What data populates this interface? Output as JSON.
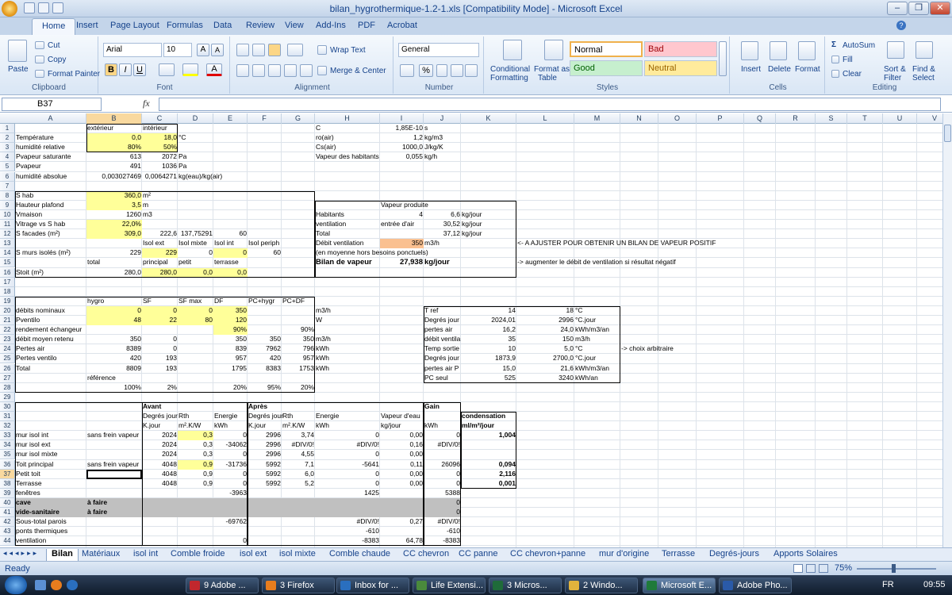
{
  "window": {
    "title": "bilan_hygrothermique-1.2-1.xls  [Compatibility Mode] - Microsoft Excel"
  },
  "ribbon": {
    "tabs": [
      "Home",
      "Insert",
      "Page Layout",
      "Formulas",
      "Data",
      "Review",
      "View",
      "Add-Ins",
      "PDF",
      "Acrobat"
    ],
    "clipboard": {
      "paste": "Paste",
      "cut": "Cut",
      "copy": "Copy",
      "format_painter": "Format Painter",
      "label": "Clipboard"
    },
    "font": {
      "name": "Arial",
      "size": "10",
      "label": "Font"
    },
    "alignment": {
      "wrap": "Wrap Text",
      "merge": "Merge & Center",
      "label": "Alignment"
    },
    "number": {
      "format": "General",
      "label": "Number"
    },
    "styles": {
      "conditional": "Conditional",
      "formatting": "Formatting",
      "format_as": "Format as",
      "table": "Table",
      "normal": "Normal",
      "bad": "Bad",
      "good": "Good",
      "neutral": "Neutral",
      "label": "Styles"
    },
    "cells": {
      "insert": "Insert",
      "delete": "Delete",
      "format": "Format",
      "label": "Cells"
    },
    "editing": {
      "autosum": "AutoSum",
      "fill": "Fill",
      "clear": "Clear",
      "sort": "Sort &",
      "filter": "Filter",
      "find": "Find &",
      "select": "Select",
      "label": "Editing"
    }
  },
  "formula_bar": {
    "name_box": "B37",
    "fx": "fx",
    "formula": ""
  },
  "columns": [
    "A",
    "B",
    "C",
    "D",
    "E",
    "F",
    "G",
    "H",
    "I",
    "J",
    "K",
    "L",
    "M",
    "N",
    "O",
    "P",
    "Q",
    "R",
    "S",
    "T",
    "U",
    "V"
  ],
  "rows": [
    "1",
    "2",
    "3",
    "4",
    "5",
    "6",
    "7",
    "8",
    "9",
    "10",
    "11",
    "12",
    "13",
    "14",
    "15",
    "16",
    "17",
    "18",
    "19",
    "20",
    "21",
    "22",
    "23",
    "24",
    "25",
    "26",
    "27",
    "28",
    "29",
    "30",
    "31",
    "32",
    "33",
    "34",
    "35",
    "36",
    "37",
    "38",
    "39",
    "40",
    "41",
    "42",
    "43",
    "44"
  ],
  "cells": [
    [
      "B1",
      "extérieur"
    ],
    [
      "C1",
      "intérieur"
    ],
    [
      "H1",
      "C"
    ],
    [
      "I1",
      "1,85E-10"
    ],
    [
      "J1",
      "s"
    ],
    [
      "A2",
      "Température"
    ],
    [
      "B2",
      "0,0"
    ],
    [
      "C2",
      "18,0"
    ],
    [
      "D2",
      "°C"
    ],
    [
      "H2",
      "ro(air)"
    ],
    [
      "I2",
      "1,2"
    ],
    [
      "J2",
      "kg/m3"
    ],
    [
      "A3",
      "humidité relative"
    ],
    [
      "B3",
      "80%"
    ],
    [
      "C3",
      "50%"
    ],
    [
      "H3",
      "Cs(air)"
    ],
    [
      "I3",
      "1000,0"
    ],
    [
      "J3",
      "J/kg/K"
    ],
    [
      "A4",
      "Pvapeur saturante"
    ],
    [
      "B4",
      "613"
    ],
    [
      "C4",
      "2072"
    ],
    [
      "D4",
      "Pa"
    ],
    [
      "H4",
      "Vapeur des habitants"
    ],
    [
      "I4",
      "0,055"
    ],
    [
      "J4",
      "kg/h"
    ],
    [
      "A5",
      "Pvapeur"
    ],
    [
      "B5",
      "491"
    ],
    [
      "C5",
      "1036"
    ],
    [
      "D5",
      "Pa"
    ],
    [
      "A6",
      "humidité absolue"
    ],
    [
      "B6",
      "0,003027469"
    ],
    [
      "C6",
      "0,0064271"
    ],
    [
      "D6",
      "kg(eau)/kg(air)"
    ],
    [
      "A8",
      "S hab"
    ],
    [
      "B8",
      "360,0"
    ],
    [
      "C8",
      "m²"
    ],
    [
      "A9",
      "Hauteur plafond"
    ],
    [
      "B9",
      "3,5"
    ],
    [
      "C9",
      "m"
    ],
    [
      "I9",
      "Vapeur produite"
    ],
    [
      "A10",
      "Vmaison"
    ],
    [
      "B10",
      "1260"
    ],
    [
      "C10",
      "m3"
    ],
    [
      "H10",
      "Habitants"
    ],
    [
      "I10",
      "4"
    ],
    [
      "J10",
      "6,6"
    ],
    [
      "K10",
      "kg/jour"
    ],
    [
      "A11",
      "Vitrage vs S hab"
    ],
    [
      "B11",
      "22,0%"
    ],
    [
      "H11",
      "ventilation"
    ],
    [
      "I11",
      "entrée d'air"
    ],
    [
      "J11",
      "30,52"
    ],
    [
      "K11",
      "kg/jour"
    ],
    [
      "A12",
      "S facades (m²)"
    ],
    [
      "B12",
      "309,0"
    ],
    [
      "C12",
      "222,6"
    ],
    [
      "D12",
      "137,75291"
    ],
    [
      "E12",
      "60"
    ],
    [
      "H12",
      "Total"
    ],
    [
      "J12",
      "37,12"
    ],
    [
      "K12",
      "kg/jour"
    ],
    [
      "C13",
      "Isol ext"
    ],
    [
      "D13",
      "Isol mixte"
    ],
    [
      "E13",
      "Isol int"
    ],
    [
      "F13",
      "Isol periph"
    ],
    [
      "H13",
      "Débit ventilation"
    ],
    [
      "I13",
      "350"
    ],
    [
      "J13",
      "m3/h"
    ],
    [
      "L13",
      "<- A AJUSTER POUR OBTENIR UN BILAN DE VAPEUR POSITIF"
    ],
    [
      "A14",
      "S murs isolés (m²)"
    ],
    [
      "B14",
      "229"
    ],
    [
      "C14",
      "229"
    ],
    [
      "D14",
      "0"
    ],
    [
      "E14",
      "0"
    ],
    [
      "F14",
      "60"
    ],
    [
      "H14",
      "(en moyenne hors besoins ponctuels)"
    ],
    [
      "B15",
      "total"
    ],
    [
      "C15",
      "principal"
    ],
    [
      "D15",
      "petit"
    ],
    [
      "E15",
      "terrasse"
    ],
    [
      "H15",
      "Bilan de vapeur"
    ],
    [
      "I15",
      "27,938"
    ],
    [
      "J15",
      "kg/jour"
    ],
    [
      "L15",
      "-> augmenter le débit de ventilation si résultat négatif"
    ],
    [
      "A16",
      "Stoit (m²)"
    ],
    [
      "B16",
      "280,0"
    ],
    [
      "C16",
      "280,0"
    ],
    [
      "D16",
      "0,0"
    ],
    [
      "E16",
      "0,0"
    ],
    [
      "B19",
      "hygro"
    ],
    [
      "C19",
      "SF"
    ],
    [
      "D19",
      "SF max"
    ],
    [
      "E19",
      "DF"
    ],
    [
      "F19",
      "PC+hygr"
    ],
    [
      "G19",
      "PC+DF"
    ],
    [
      "A20",
      "débits nominaux"
    ],
    [
      "B20",
      "0"
    ],
    [
      "C20",
      "0"
    ],
    [
      "D20",
      "0"
    ],
    [
      "E20",
      "350"
    ],
    [
      "H20",
      "m3/h"
    ],
    [
      "J20",
      "T ref"
    ],
    [
      "K20",
      "14"
    ],
    [
      "L20",
      "18"
    ],
    [
      "M20",
      "°C"
    ],
    [
      "A21",
      "Pventilo"
    ],
    [
      "B21",
      "48"
    ],
    [
      "C21",
      "22"
    ],
    [
      "D21",
      "80"
    ],
    [
      "E21",
      "120"
    ],
    [
      "H21",
      "W"
    ],
    [
      "J21",
      "Degrés jour"
    ],
    [
      "K21",
      "2024,01"
    ],
    [
      "L21",
      "2996"
    ],
    [
      "M21",
      "°C.jour"
    ],
    [
      "A22",
      "rendement échangeur"
    ],
    [
      "E22",
      "90%"
    ],
    [
      "G22",
      "90%"
    ],
    [
      "J22",
      "pertes air"
    ],
    [
      "K22",
      "16,2"
    ],
    [
      "L22",
      "24,0"
    ],
    [
      "M22",
      "kWh/m3/an"
    ],
    [
      "A23",
      "débit moyen retenu"
    ],
    [
      "B23",
      "350"
    ],
    [
      "C23",
      "0"
    ],
    [
      "E23",
      "350"
    ],
    [
      "F23",
      "350"
    ],
    [
      "G23",
      "350"
    ],
    [
      "H23",
      "m3/h"
    ],
    [
      "J23",
      "débit ventila"
    ],
    [
      "K23",
      "35"
    ],
    [
      "L23",
      "150"
    ],
    [
      "M23",
      "m3/h"
    ],
    [
      "A24",
      "Pertes air"
    ],
    [
      "B24",
      "8389"
    ],
    [
      "C24",
      "0"
    ],
    [
      "E24",
      "839"
    ],
    [
      "F24",
      "7962"
    ],
    [
      "G24",
      "796"
    ],
    [
      "H24",
      "kWh"
    ],
    [
      "J24",
      "Temp sortie"
    ],
    [
      "K24",
      "10"
    ],
    [
      "L24",
      "5,0"
    ],
    [
      "M24",
      "°C"
    ],
    [
      "N24",
      "-> choix arbitraire"
    ],
    [
      "A25",
      "Pertes ventilo"
    ],
    [
      "B25",
      "420"
    ],
    [
      "C25",
      "193"
    ],
    [
      "E25",
      "957"
    ],
    [
      "F25",
      "420"
    ],
    [
      "G25",
      "957"
    ],
    [
      "H25",
      "kWh"
    ],
    [
      "J25",
      "Degrés jour"
    ],
    [
      "K25",
      "1873,9"
    ],
    [
      "L25",
      "2700,0"
    ],
    [
      "M25",
      "°C.jour"
    ],
    [
      "A26",
      "Total"
    ],
    [
      "B26",
      "8809"
    ],
    [
      "C26",
      "193"
    ],
    [
      "E26",
      "1795"
    ],
    [
      "F26",
      "8383"
    ],
    [
      "G26",
      "1753"
    ],
    [
      "H26",
      "kWh"
    ],
    [
      "J26",
      "pertes air P"
    ],
    [
      "K26",
      "15,0"
    ],
    [
      "L26",
      "21,6"
    ],
    [
      "M26",
      "kWh/m3/an"
    ],
    [
      "B27",
      "référence"
    ],
    [
      "J27",
      "PC seul"
    ],
    [
      "K27",
      "525"
    ],
    [
      "L27",
      "3240"
    ],
    [
      "M27",
      "kWh/an"
    ],
    [
      "B28",
      "100%"
    ],
    [
      "C28",
      "2%"
    ],
    [
      "E28",
      "20%"
    ],
    [
      "F28",
      "95%"
    ],
    [
      "G28",
      "20%"
    ],
    [
      "C30",
      "Avant"
    ],
    [
      "F30",
      "Après"
    ],
    [
      "J30",
      "Gain"
    ],
    [
      "C31",
      "Degrés jour"
    ],
    [
      "D31",
      "Rth"
    ],
    [
      "E31",
      "Energie"
    ],
    [
      "F31",
      "Degrés jour"
    ],
    [
      "G31",
      "Rth"
    ],
    [
      "H31",
      "Energie"
    ],
    [
      "I31",
      "Vapeur d'eau"
    ],
    [
      "K31",
      "condensation"
    ],
    [
      "C32",
      "K.jour"
    ],
    [
      "D32",
      "m².K/W"
    ],
    [
      "E32",
      "kWh"
    ],
    [
      "F32",
      "K.jour"
    ],
    [
      "G32",
      "m².K/W"
    ],
    [
      "H32",
      "kWh"
    ],
    [
      "I32",
      "kg/jour"
    ],
    [
      "J32",
      "kWh"
    ],
    [
      "K32",
      "ml/m²/jour"
    ],
    [
      "A33",
      "mur isol int"
    ],
    [
      "B33",
      "sans frein vapeur"
    ],
    [
      "C33",
      "2024"
    ],
    [
      "D33",
      "0,3"
    ],
    [
      "E33",
      "0"
    ],
    [
      "F33",
      "2996"
    ],
    [
      "G33",
      "3,74"
    ],
    [
      "H33",
      "0"
    ],
    [
      "I33",
      "0,00"
    ],
    [
      "J33",
      "0"
    ],
    [
      "K33",
      "1,004"
    ],
    [
      "A34",
      "mur isol ext"
    ],
    [
      "C34",
      "2024"
    ],
    [
      "D34",
      "0,3"
    ],
    [
      "E34",
      "-34062"
    ],
    [
      "F34",
      "2996"
    ],
    [
      "G34",
      "#DIV/0!"
    ],
    [
      "H34",
      "#DIV/0!"
    ],
    [
      "I34",
      "0,16"
    ],
    [
      "J34",
      "#DIV/0!"
    ],
    [
      "A35",
      "mur isol mixte"
    ],
    [
      "C35",
      "2024"
    ],
    [
      "D35",
      "0,3"
    ],
    [
      "E35",
      "0"
    ],
    [
      "F35",
      "2996"
    ],
    [
      "G35",
      "4,55"
    ],
    [
      "H35",
      "0"
    ],
    [
      "I35",
      "0,00"
    ],
    [
      "A36",
      "Toit principal"
    ],
    [
      "B36",
      "sans frein vapeur"
    ],
    [
      "C36",
      "4048"
    ],
    [
      "D36",
      "0,9"
    ],
    [
      "E36",
      "-31736"
    ],
    [
      "F36",
      "5992"
    ],
    [
      "G36",
      "7,1"
    ],
    [
      "H36",
      "-5641"
    ],
    [
      "I36",
      "0,11"
    ],
    [
      "J36",
      "26096"
    ],
    [
      "K36",
      "0,094"
    ],
    [
      "A37",
      "Petit toit"
    ],
    [
      "C37",
      "4048"
    ],
    [
      "D37",
      "0,9"
    ],
    [
      "E37",
      "0"
    ],
    [
      "F37",
      "5992"
    ],
    [
      "G37",
      "6,0"
    ],
    [
      "H37",
      "0"
    ],
    [
      "I37",
      "0,00"
    ],
    [
      "J37",
      "0"
    ],
    [
      "K37",
      "2,116"
    ],
    [
      "A38",
      "Terrasse"
    ],
    [
      "C38",
      "4048"
    ],
    [
      "D38",
      "0,9"
    ],
    [
      "E38",
      "0"
    ],
    [
      "F38",
      "5992"
    ],
    [
      "G38",
      "5,2"
    ],
    [
      "H38",
      "0"
    ],
    [
      "I38",
      "0,00"
    ],
    [
      "J38",
      "0"
    ],
    [
      "K38",
      "0,001"
    ],
    [
      "A39",
      "fenêtres"
    ],
    [
      "E39",
      "-3963"
    ],
    [
      "H39",
      "1425"
    ],
    [
      "J39",
      "5388"
    ],
    [
      "A40",
      "cave"
    ],
    [
      "B40",
      "à faire"
    ],
    [
      "J40",
      "0"
    ],
    [
      "A41",
      "vide-sanitaire"
    ],
    [
      "B41",
      "à faire"
    ],
    [
      "J41",
      "0"
    ],
    [
      "A42",
      "Sous-total parois"
    ],
    [
      "E42",
      "-69762"
    ],
    [
      "H42",
      "#DIV/0!"
    ],
    [
      "I42",
      "0,27"
    ],
    [
      "J42",
      "#DIV/0!"
    ],
    [
      "A43",
      "ponts thermiques"
    ],
    [
      "H43",
      "-610"
    ],
    [
      "J43",
      "-610"
    ],
    [
      "A44",
      "ventilation"
    ],
    [
      "E44",
      "0"
    ],
    [
      "H44",
      "-8383"
    ],
    [
      "I44",
      "64,78"
    ],
    [
      "J44",
      "-8383"
    ]
  ],
  "sheets": [
    "Bilan",
    "Matériaux",
    "isol int",
    "Comble froide",
    "isol ext",
    "isol mixte",
    "Comble chaude",
    "CC chevron",
    "CC panne",
    "CC chevron+panne",
    "mur d'origine",
    "Terrasse",
    "Degrés-jours",
    "Apports Solaires"
  ],
  "status": {
    "ready": "Ready",
    "zoom": "75%"
  },
  "taskbar": {
    "items": [
      "9 Adobe ...",
      "3 Firefox",
      "Inbox for ...",
      "Life Extensi...",
      "3 Micros...",
      "2 Windo...",
      "Microsoft E...",
      "Adobe Pho..."
    ],
    "lang": "FR",
    "clock": "09:55"
  },
  "colors": {
    "yellow": "#ffff99",
    "orange": "#fac090",
    "gray": "#c0c0c0",
    "accent": "#15428b"
  }
}
